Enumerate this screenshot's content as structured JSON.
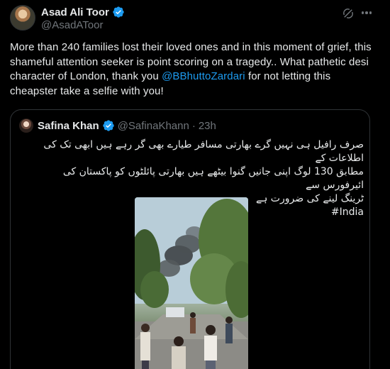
{
  "post": {
    "author": {
      "name": "Asad Ali Toor",
      "handle": "@AsadAToor"
    },
    "text_before": "More than 240 families lost their loved ones and in this moment of grief, this shameful attention seeker is point scoring on a tragedy.. What pathetic desi character of London, thank you ",
    "mention": "@BBhuttoZardari",
    "text_after": " for not letting this cheapster take a selfie with you!"
  },
  "quote": {
    "author": {
      "name": "Safina Khan",
      "handle": "@SafinaKhann",
      "separator": "·",
      "time": "23h"
    },
    "urdu_lines": [
      "صرف رافیل ہی نہیں گرے بھارتی مسافر طیارے بھی گر رہے ہیں ابھی تک کی اطلاعات کے",
      "مطابق 130 لوگ اپنی جانیں گنوا بیٹھے ہیں بھارتی پائلٹوں کو پاکستان کی ائیرفورس سے",
      "ٹرینگ لینے کی ضرورت ہے"
    ],
    "hashtag": "#India"
  },
  "colors": {
    "background": "#000000",
    "text": "#e7e9ea",
    "muted": "#71767b",
    "accent": "#1d9bf0",
    "border": "#2f3336"
  },
  "icons": [
    "verified-badge-icon",
    "grok-icon",
    "more-options-icon"
  ]
}
